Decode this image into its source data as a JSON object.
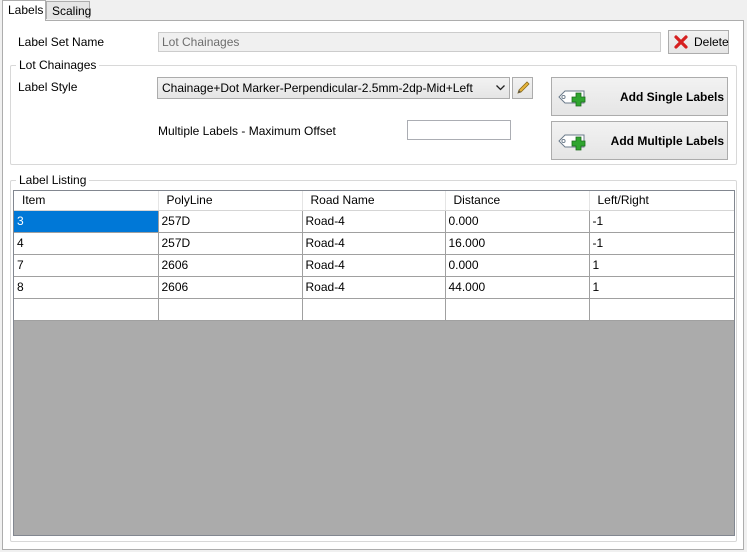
{
  "tabs": [
    {
      "label": "Labels",
      "active": true
    },
    {
      "label": "Scaling",
      "active": false
    }
  ],
  "label_set": {
    "name_label": "Label Set Name",
    "name_value": "Lot Chainages",
    "delete_label": "Delete"
  },
  "lot_chainages": {
    "group_title": "Lot Chainages",
    "style_label": "Label Style",
    "style_value": "Chainage+Dot Marker-Perpendicular-2.5mm-2dp-Mid+Left",
    "offset_label": "Multiple Labels - Maximum Offset",
    "offset_value": "",
    "add_single_label": "Add Single Labels",
    "add_multiple_label": "Add Multiple Labels"
  },
  "listing": {
    "group_title": "Label Listing",
    "columns": [
      "Item",
      "PolyLine",
      "Road Name",
      "Distance",
      "Left/Right"
    ],
    "rows": [
      [
        "3",
        "257D",
        "Road-4",
        "0.000",
        "-1"
      ],
      [
        "4",
        "257D",
        "Road-4",
        "16.000",
        "-1"
      ],
      [
        "7",
        "2606",
        "Road-4",
        "0.000",
        "1"
      ],
      [
        "8",
        "2606",
        "Road-4",
        "44.000",
        "1"
      ],
      [
        "",
        "",
        "",
        "",
        ""
      ]
    ]
  },
  "colors": {
    "selection": "#0078d7",
    "delete_icon": "#d62020",
    "add_icon": "#2fa52f",
    "grid_empty": "#ababab"
  }
}
